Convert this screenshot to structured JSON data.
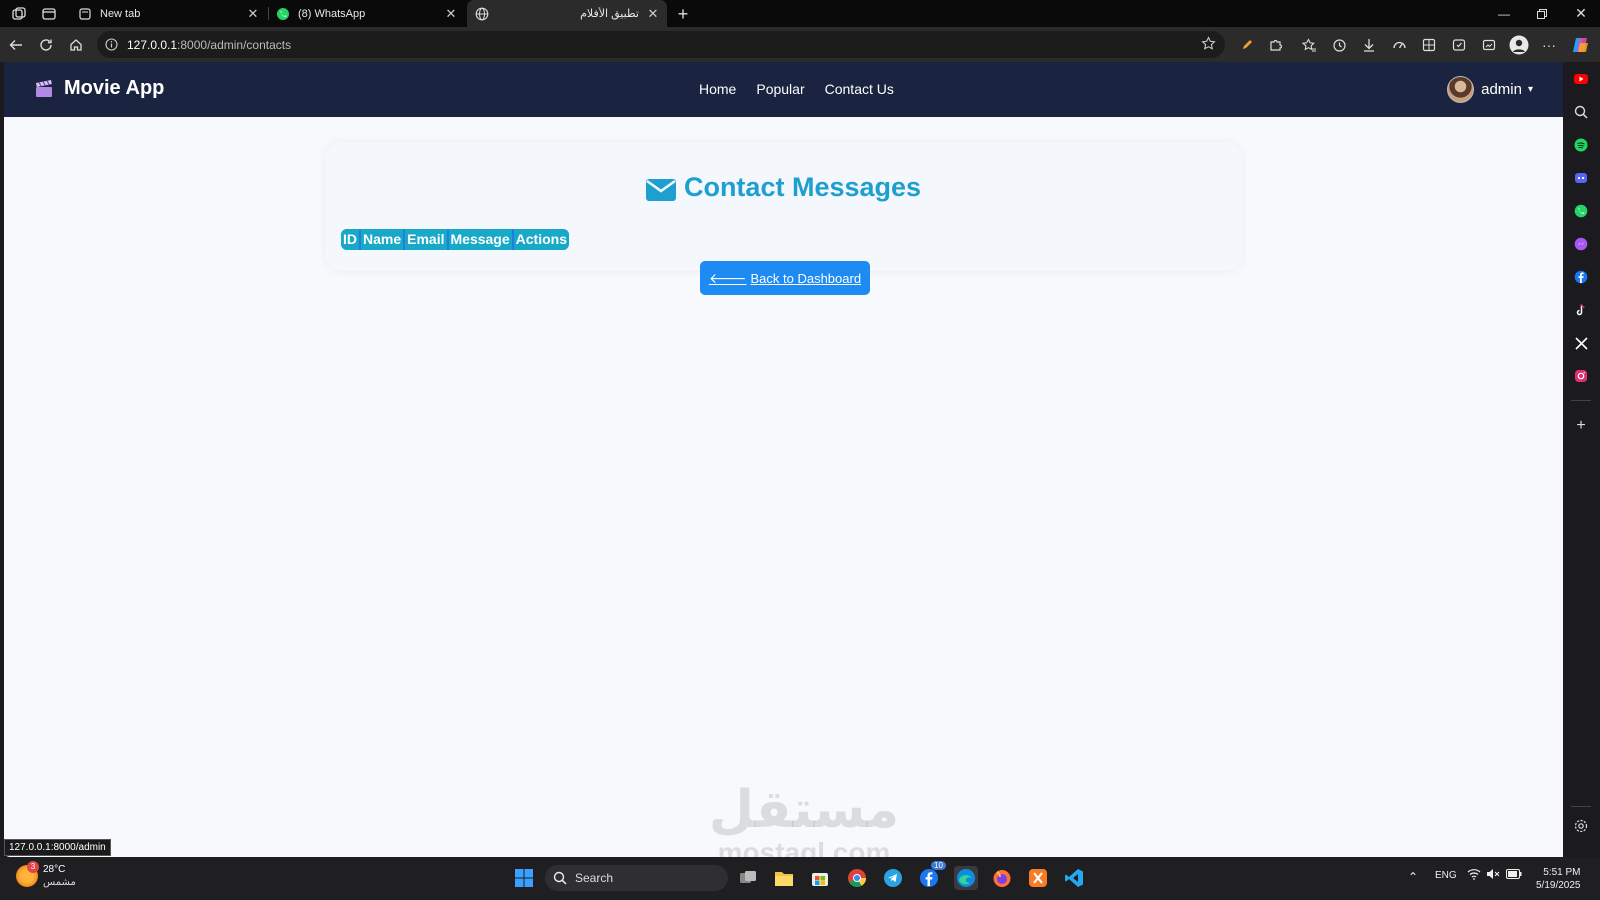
{
  "browser": {
    "tabs": [
      {
        "label": "New tab"
      },
      {
        "label": "(8) WhatsApp"
      },
      {
        "label": "تطبيق الأفلام"
      }
    ],
    "url_host": "127.0.0.1",
    "url_rest": ":8000/admin/contacts",
    "status_url": "127.0.0.1:8000/admin"
  },
  "navbar": {
    "brand": "Movie App",
    "links": [
      "Home",
      "Popular",
      "Contact Us"
    ],
    "user": "admin"
  },
  "card": {
    "title": "Contact Messages",
    "headers": [
      "ID",
      "Name",
      "Email",
      "Message",
      "Actions"
    ]
  },
  "back_button": "Back to Dashboard",
  "watermark": {
    "arabic": "مستقل",
    "latin": "mostaql.com"
  },
  "taskbar": {
    "weather_temp": "28°C",
    "weather_desc": "مشمس",
    "weather_badge": "3",
    "search_label": "Search",
    "lang": "ENG",
    "time": "5:51 PM",
    "date": "5/19/2025",
    "facebook_badge": "10"
  },
  "colors": {
    "navbar_bg": "#1a2340",
    "accent": "#1d9fd0",
    "button": "#1d8bf2",
    "page_bg": "#f7f9fc"
  }
}
